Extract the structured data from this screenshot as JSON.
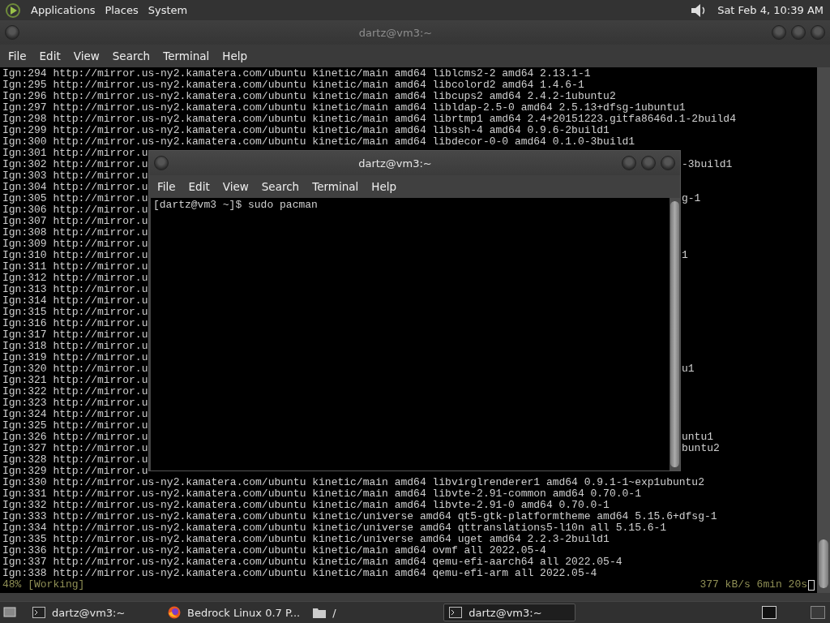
{
  "top_panel": {
    "menus": [
      "Applications",
      "Places",
      "System"
    ],
    "clock": "Sat Feb  4, 10:39 AM"
  },
  "background_window": {
    "title": "dartz@vm3:~",
    "menu": [
      "File",
      "Edit",
      "View",
      "Search",
      "Terminal",
      "Help"
    ],
    "lines": [
      {
        "text": "Ign:294 http://mirror.us-ny2.kamatera.com/ubuntu kinetic/main amd64 liblcms2-2 amd64 2.13.1-1"
      },
      {
        "text": "Ign:295 http://mirror.us-ny2.kamatera.com/ubuntu kinetic/main amd64 libcolord2 amd64 1.4.6-1"
      },
      {
        "text": "Ign:296 http://mirror.us-ny2.kamatera.com/ubuntu kinetic/main amd64 libcups2 amd64 2.4.2-1ubuntu2"
      },
      {
        "text": "Ign:297 http://mirror.us-ny2.kamatera.com/ubuntu kinetic/main amd64 libldap-2.5-0 amd64 2.5.13+dfsg-1ubuntu1"
      },
      {
        "text": "Ign:298 http://mirror.us-ny2.kamatera.com/ubuntu kinetic/main amd64 librtmp1 amd64 2.4+20151223.gitfa8646d.1-2build4"
      },
      {
        "text": "Ign:299 http://mirror.us-ny2.kamatera.com/ubuntu kinetic/main amd64 libssh-4 amd64 0.9.6-2build1"
      },
      {
        "text": "Ign:300 http://mirror.us-ny2.kamatera.com/ubuntu kinetic/main amd64 libdecor-0-0 amd64 0.1.0-3build1"
      },
      {
        "text": "Ign:301 http://mirror.u"
      },
      {
        "text": "Ign:302 http://mirror.u",
        "tail": "-3build1"
      },
      {
        "text": "Ign:303 http://mirror.u"
      },
      {
        "text": "Ign:304 http://mirror.u"
      },
      {
        "text": "Ign:305 http://mirror.u",
        "tail": "g-1"
      },
      {
        "text": "Ign:306 http://mirror.u"
      },
      {
        "text": "Ign:307 http://mirror.u"
      },
      {
        "text": "Ign:308 http://mirror.u"
      },
      {
        "text": "Ign:309 http://mirror.u"
      },
      {
        "text": "Ign:310 http://mirror.u",
        "tail": "1"
      },
      {
        "text": "Ign:311 http://mirror.u"
      },
      {
        "text": "Ign:312 http://mirror.u"
      },
      {
        "text": "Ign:313 http://mirror.u"
      },
      {
        "text": "Ign:314 http://mirror.u"
      },
      {
        "text": "Ign:315 http://mirror.u"
      },
      {
        "text": "Ign:316 http://mirror.u"
      },
      {
        "text": "Ign:317 http://mirror.u"
      },
      {
        "text": "Ign:318 http://mirror.u"
      },
      {
        "text": "Ign:319 http://mirror.u"
      },
      {
        "text": "Ign:320 http://mirror.u",
        "tail": "u1"
      },
      {
        "text": "Ign:321 http://mirror.u"
      },
      {
        "text": "Ign:322 http://mirror.u"
      },
      {
        "text": "Ign:323 http://mirror.u"
      },
      {
        "text": "Ign:324 http://mirror.u"
      },
      {
        "text": "Ign:325 http://mirror.u"
      },
      {
        "text": "Ign:326 http://mirror.u",
        "tail": "untu1"
      },
      {
        "text": "Ign:327 http://mirror.u",
        "tail": "buntu2"
      },
      {
        "text": "Ign:328 http://mirror.u"
      },
      {
        "text": "Ign:329 http://mirror.u"
      },
      {
        "text": "Ign:330 http://mirror.us-ny2.kamatera.com/ubuntu kinetic/main amd64 libvirglrenderer1 amd64 0.9.1-1~exp1ubuntu2"
      },
      {
        "text": "Ign:331 http://mirror.us-ny2.kamatera.com/ubuntu kinetic/main amd64 libvte-2.91-common amd64 0.70.0-1"
      },
      {
        "text": "Ign:332 http://mirror.us-ny2.kamatera.com/ubuntu kinetic/main amd64 libvte-2.91-0 amd64 0.70.0-1"
      },
      {
        "text": "Ign:333 http://mirror.us-ny2.kamatera.com/ubuntu kinetic/universe amd64 qt5-gtk-platformtheme amd64 5.15.6+dfsg-1"
      },
      {
        "text": "Ign:334 http://mirror.us-ny2.kamatera.com/ubuntu kinetic/universe amd64 qttranslations5-l10n all 5.15.6-1"
      },
      {
        "text": "Ign:335 http://mirror.us-ny2.kamatera.com/ubuntu kinetic/universe amd64 uget amd64 2.2.3-2build1"
      },
      {
        "text": "Ign:336 http://mirror.us-ny2.kamatera.com/ubuntu kinetic/main amd64 ovmf all 2022.05-4"
      },
      {
        "text": "Ign:337 http://mirror.us-ny2.kamatera.com/ubuntu kinetic/main amd64 qemu-efi-aarch64 all 2022.05-4"
      },
      {
        "text": "Ign:338 http://mirror.us-ny2.kamatera.com/ubuntu kinetic/main amd64 qemu-efi-arm all 2022.05-4"
      }
    ],
    "status": {
      "progress": "48% [Working]",
      "speed": "377 kB/s 6min 20s"
    }
  },
  "foreground_window": {
    "title": "dartz@vm3:~",
    "menu": [
      "File",
      "Edit",
      "View",
      "Search",
      "Terminal",
      "Help"
    ],
    "lines": [
      "[dartz@vm3 ~]$ sudo pacman"
    ]
  },
  "taskbar": {
    "items": [
      {
        "kind": "terminal",
        "label": "dartz@vm3:~",
        "selected": false
      },
      {
        "kind": "browser",
        "label": "Bedrock Linux 0.7 P...",
        "selected": false
      },
      {
        "kind": "folder",
        "label": "/",
        "selected": false
      },
      {
        "kind": "terminal",
        "label": "dartz@vm3:~",
        "selected": true
      }
    ]
  }
}
